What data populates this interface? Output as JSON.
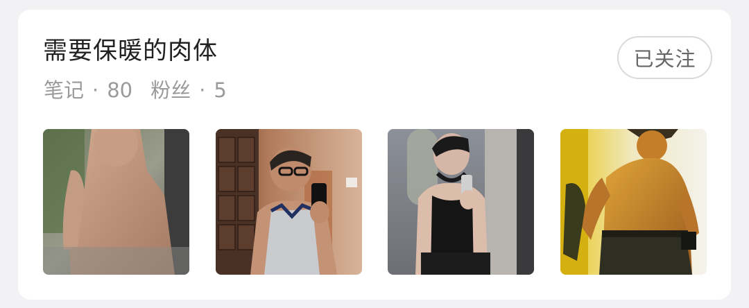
{
  "collection": {
    "title": "需要保暖的肉体",
    "notes_label": "笔记",
    "separator": "·",
    "notes_count": "80",
    "fans_label": "粉丝",
    "fans_count": "5",
    "follow_button_label": "已关注"
  },
  "colors": {
    "card_background": "#ffffff",
    "page_background": "#f2f2f4",
    "title": "#222222",
    "stats": "#9a9a9a",
    "button_border": "#d9d9d9"
  },
  "thumbnails": [
    {
      "name": "shirtless-man-by-window-photo"
    },
    {
      "name": "gym-mirror-selfie-glasses-photo"
    },
    {
      "name": "black-tank-top-mirror-selfie-photo"
    },
    {
      "name": "shirtless-man-yellow-light-photo"
    }
  ]
}
